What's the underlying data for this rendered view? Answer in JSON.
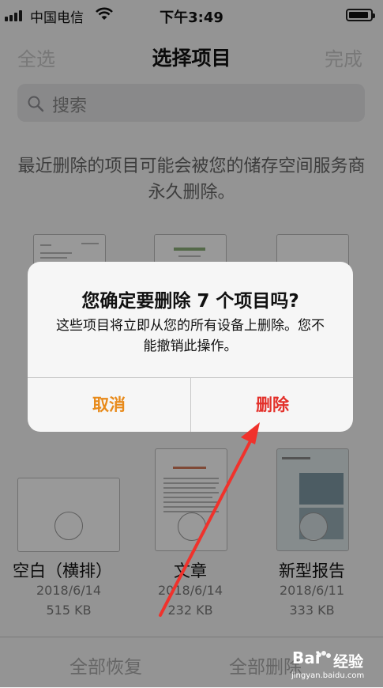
{
  "status_bar": {
    "carrier": "中国电信",
    "time": "下午3:49"
  },
  "nav": {
    "select_all": "全选",
    "title": "选择项目",
    "done": "完成"
  },
  "search": {
    "placeholder": "搜索"
  },
  "notice": "最近删除的项目可能会被您的储存空间服务商永久删除。",
  "documents": [
    {
      "title": "空白（横排）",
      "date": "2018/6/14",
      "size": "515 KB"
    },
    {
      "title": "文章",
      "date": "2018/6/14",
      "size": "232 KB"
    },
    {
      "title": "新型报告",
      "date": "2018/6/11",
      "size": "333 KB"
    }
  ],
  "bottom_bar": {
    "recover_all": "全部恢复",
    "delete_all": "全部删除"
  },
  "alert": {
    "title": "您确定要删除 7 个项目吗?",
    "message": "这些项目将立即从您的所有设备上删除。您不能撤销此操作。",
    "cancel": "取消",
    "delete": "删除"
  },
  "watermark": {
    "brand": "Bai",
    "brand_cn": "经验",
    "url": "jingyan.baidu.com"
  },
  "colors": {
    "cancel": "#e88a1a",
    "delete": "#e3302a",
    "annotation_arrow": "#f0322c"
  },
  "icons": {
    "search": "magnifier-icon",
    "wifi": "wifi-icon",
    "battery": "battery-icon",
    "signal": "signal-bars-icon"
  }
}
